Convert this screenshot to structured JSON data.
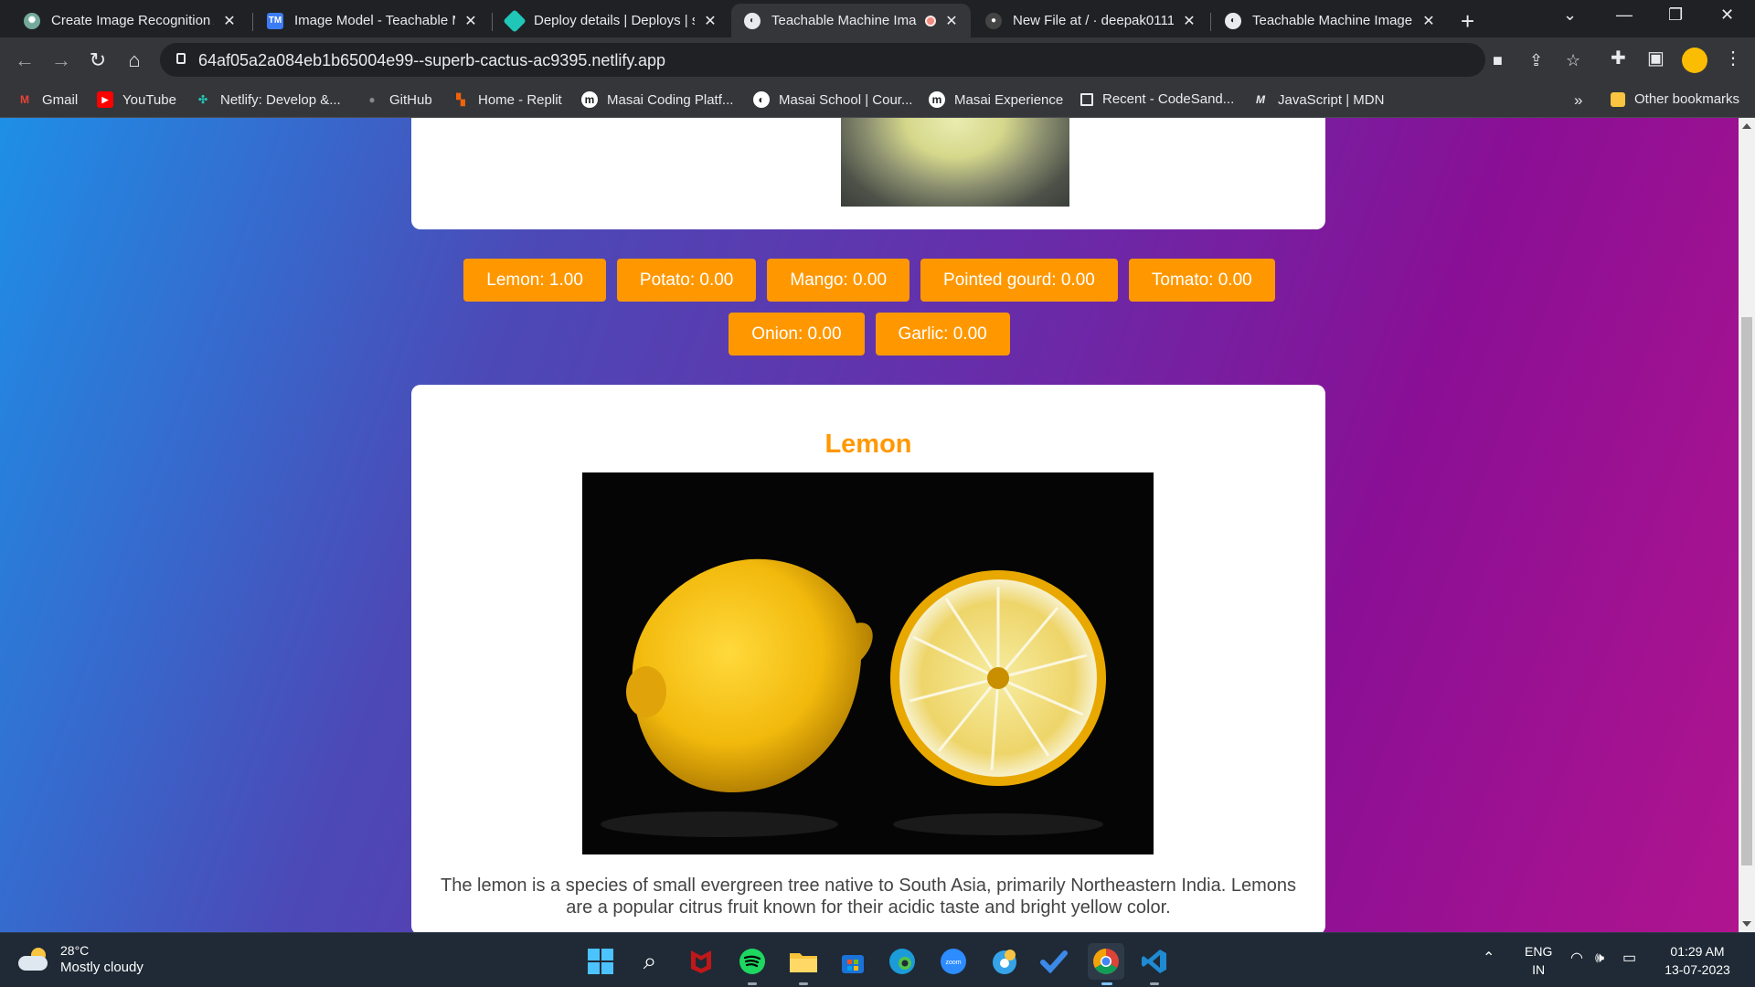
{
  "browser": {
    "tabs": [
      {
        "title": "Create Image Recognition A",
        "favicon": "chatgpt-icon",
        "color": "#74aa9c"
      },
      {
        "title": "Image Model - Teachable M",
        "favicon": "tm-icon",
        "color": "#3b7cf4"
      },
      {
        "title": "Deploy details | Deploys | su",
        "favicon": "netlify-icon",
        "color": "#20c6b7"
      },
      {
        "title": "Teachable Machine Ima",
        "favicon": "globe-icon",
        "color": "#e8eaed",
        "active": true
      },
      {
        "title": "New File at / · deepak0111",
        "favicon": "github-icon",
        "color": "#444"
      },
      {
        "title": "Teachable Machine Image M",
        "favicon": "globe-icon",
        "color": "#e8eaed"
      }
    ],
    "url": "64af05a2a084eb1b65004e99--superb-cactus-ac9395.netlify.app",
    "bookmarks": [
      {
        "label": "Gmail",
        "icon": "gmail-icon",
        "color": "#ea4335"
      },
      {
        "label": "YouTube",
        "icon": "youtube-icon",
        "color": "#ff0000"
      },
      {
        "label": "Netlify: Develop &...",
        "icon": "netlify-icon",
        "color": "#20c6b7"
      },
      {
        "label": "GitHub",
        "icon": "github-icon",
        "color": "#444"
      },
      {
        "label": "Home - Replit",
        "icon": "replit-icon",
        "color": "#f26207"
      },
      {
        "label": "Masai Coding Platf...",
        "icon": "masai-icon",
        "color": "#fff"
      },
      {
        "label": "Masai School | Cour...",
        "icon": "globe-icon",
        "color": "#fff"
      },
      {
        "label": "Masai Experience",
        "icon": "masai-icon",
        "color": "#fff"
      },
      {
        "label": "Recent - CodeSand...",
        "icon": "codesandbox-icon",
        "color": "#fff"
      },
      {
        "label": "JavaScript | MDN",
        "icon": "mdn-icon",
        "color": "#fff"
      }
    ],
    "more_bookmarks": "»",
    "other_bookmarks": "Other bookmarks"
  },
  "page": {
    "predictions_row1": [
      "Lemon: 1.00",
      "Potato: 0.00",
      "Mango: 0.00",
      "Pointed gourd: 0.00",
      "Tomato: 0.00"
    ],
    "predictions_row2": [
      "Onion: 0.00",
      "Garlic: 0.00"
    ],
    "result_title": "Lemon",
    "result_description": "The lemon is a species of small evergreen tree native to South Asia, primarily Northeastern India. Lemons are a popular citrus fruit known for their acidic taste and bright yellow color.",
    "accent_color": "#ff9800"
  },
  "taskbar": {
    "weather_temp": "28°C",
    "weather_condition": "Mostly cloudy",
    "language_top": "ENG",
    "language_bottom": "IN",
    "time": "01:29 AM",
    "date": "13-07-2023"
  }
}
